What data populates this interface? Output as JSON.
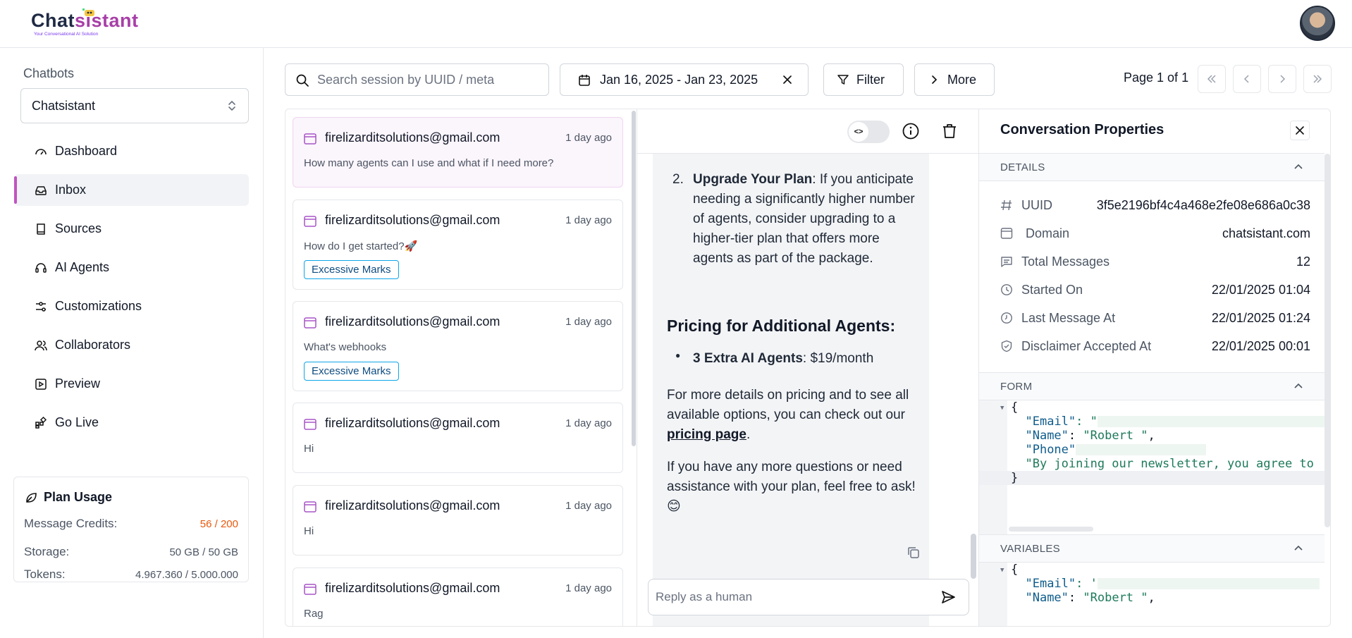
{
  "brand": {
    "logo_text_a": "Chat",
    "logo_text_b": "sistant",
    "tagline": "Your Conversational AI Solution"
  },
  "sidebar": {
    "heading": "Chatbots",
    "selected_bot": "Chatsistant",
    "items": [
      {
        "label": "Dashboard",
        "icon": "gauge-icon"
      },
      {
        "label": "Inbox",
        "icon": "inbox-icon",
        "active": true
      },
      {
        "label": "Sources",
        "icon": "book-icon"
      },
      {
        "label": "AI Agents",
        "icon": "headset-icon"
      },
      {
        "label": "Customizations",
        "icon": "sliders-icon"
      },
      {
        "label": "Collaborators",
        "icon": "users-icon"
      },
      {
        "label": "Preview",
        "icon": "play-square-icon"
      },
      {
        "label": "Go Live",
        "icon": "widgets-icon"
      }
    ],
    "usage": {
      "title": "Plan Usage",
      "rows": [
        {
          "label": "Message Credits:",
          "value": "56 / 200"
        },
        {
          "label": "Storage:",
          "value": "50 GB / 50 GB"
        },
        {
          "label": "Tokens:",
          "value": "4.967.360 / 5.000.000"
        }
      ]
    }
  },
  "toolbar": {
    "search_placeholder": "Search session by UUID / meta",
    "date_range": "Jan 16, 2025 - Jan 23, 2025",
    "filter_label": "Filter",
    "more_label": "More",
    "page_label": "Page 1 of 1"
  },
  "sessions": [
    {
      "email": "firelizarditsolutions@gmail.com",
      "time": "1 day ago",
      "preview": "How many agents can I use and what if I need more?",
      "tag": ""
    },
    {
      "email": "firelizarditsolutions@gmail.com",
      "time": "1 day ago",
      "preview": "How do I get started?🚀",
      "tag": "Excessive Marks"
    },
    {
      "email": "firelizarditsolutions@gmail.com",
      "time": "1 day ago",
      "preview": "What's webhooks",
      "tag": "Excessive Marks"
    },
    {
      "email": "firelizarditsolutions@gmail.com",
      "time": "1 day ago",
      "preview": "Hi",
      "tag": ""
    },
    {
      "email": "firelizarditsolutions@gmail.com",
      "time": "1 day ago",
      "preview": "Hi",
      "tag": ""
    },
    {
      "email": "firelizarditsolutions@gmail.com",
      "time": "1 day ago",
      "preview": "Rag",
      "tag": ""
    }
  ],
  "chat": {
    "list_number": "2.",
    "item_bold": "Upgrade Your Plan",
    "item_text": ": If you anticipate needing a significantly higher number of agents, consider upgrading to a higher-tier plan that offers more agents as part of the package.",
    "heading": "Pricing for Additional Agents:",
    "bullet_bold": "3 Extra AI Agents",
    "bullet_text": ": $19/month",
    "para1_a": "For more details on pricing and to see all available options, you can check out our ",
    "para1_link": "pricing page",
    "para1_b": ".",
    "para2": "If you have any more questions or need assistance with your plan, feel free to ask! 😊",
    "reply_placeholder": "Reply as a human",
    "toggle_glyph": "<>"
  },
  "properties": {
    "title": "Conversation Properties",
    "details_title": "DETAILS",
    "details": [
      {
        "label": "UUID",
        "value": "3f5e2196bf4c4a468e2fe08e686a0c38",
        "icon": "hash-icon"
      },
      {
        "label": "Domain",
        "value": "chatsistant.com",
        "icon": "browser-icon"
      },
      {
        "label": "Total Messages",
        "value": "12",
        "icon": "message-icon"
      },
      {
        "label": "Started On",
        "value": "22/01/2025 01:04",
        "icon": "clock-icon"
      },
      {
        "label": "Last Message At",
        "value": "22/01/2025 01:24",
        "icon": "clock-icon"
      },
      {
        "label": "Disclaimer Accepted At",
        "value": "22/01/2025 00:01",
        "icon": "shield-check-icon"
      }
    ],
    "form_title": "FORM",
    "form_code": {
      "open": "{",
      "email_key": "\"Email\"",
      "email_val": ": \"",
      "name_key": "\"Name\"",
      "name_val": "\"Robert \"",
      "phone_key": "\"Phone\"",
      "newsletter": "\"By joining our newsletter, you agree to",
      "close": "}"
    },
    "variables_title": "VARIABLES",
    "variables_code": {
      "open": "{",
      "email_key": "\"Email\"",
      "email_val": ": '",
      "name_key": "\"Name\"",
      "name_val": "\"Robert \""
    }
  }
}
